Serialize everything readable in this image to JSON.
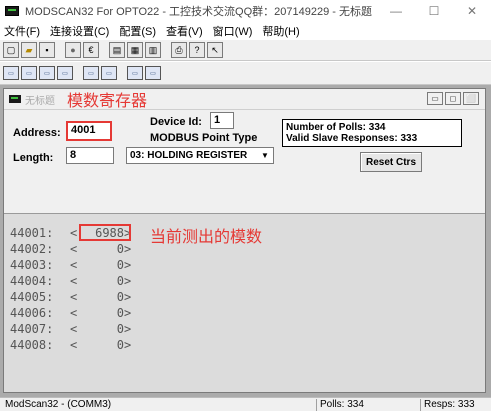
{
  "window": {
    "title": "MODSCAN32 For OPTO22 - 工控技术交流QQ群：207149229 - 无标题",
    "controls": [
      "—",
      "☐",
      "✕"
    ]
  },
  "menu": [
    "文件(F)",
    "连接设置(C)",
    "配置(S)",
    "查看(V)",
    "窗口(W)",
    "帮助(H)"
  ],
  "child": {
    "title": "无标题",
    "annotation_title": "模数寄存器",
    "controls": [
      "▭",
      "◻",
      "⬜"
    ]
  },
  "form": {
    "address_label": "Address:",
    "address_value": "4001",
    "length_label": "Length:",
    "length_value": "8",
    "device_id_label": "Device Id:",
    "device_id_value": "1",
    "point_type_label": "MODBUS Point Type",
    "point_type_value": "03: HOLDING REGISTER",
    "polls_text": "Number of Polls: 334",
    "responses_text": "Valid Slave Responses: 333",
    "reset_button": "Reset Ctrs"
  },
  "data_rows": [
    {
      "addr": "44001:",
      "lt": "<",
      "val": "6988",
      "gt": ">"
    },
    {
      "addr": "44002:",
      "lt": "<",
      "val": "0",
      "gt": ">"
    },
    {
      "addr": "44003:",
      "lt": "<",
      "val": "0",
      "gt": ">"
    },
    {
      "addr": "44004:",
      "lt": "<",
      "val": "0",
      "gt": ">"
    },
    {
      "addr": "44005:",
      "lt": "<",
      "val": "0",
      "gt": ">"
    },
    {
      "addr": "44006:",
      "lt": "<",
      "val": "0",
      "gt": ">"
    },
    {
      "addr": "44007:",
      "lt": "<",
      "val": "0",
      "gt": ">"
    },
    {
      "addr": "44008:",
      "lt": "<",
      "val": "0",
      "gt": ">"
    }
  ],
  "annotation_value": "当前测出的模数",
  "status": {
    "left": "ModScan32 - (COMM3)",
    "polls": "Polls: 334",
    "resps": "Resps: 333"
  },
  "colors": {
    "annotation": "#e53935",
    "data_bg": "#dcdcdc",
    "mdi_bg": "#ababab"
  },
  "icons": {
    "toolbar1": [
      "new-icon",
      "open-icon",
      "save-icon",
      "connect-icon",
      "disconnect-icon",
      "display-icon",
      "monitor-icon",
      "setup-icon",
      "print-icon",
      "help-icon",
      "context-help-icon"
    ],
    "toolbar2": [
      "binary-view-icon",
      "decimal-view-icon",
      "hex-view-icon",
      "float-view-icon",
      "swap-view-icon",
      "double-view-icon",
      "coil-view-icon",
      "register-view-icon"
    ]
  }
}
